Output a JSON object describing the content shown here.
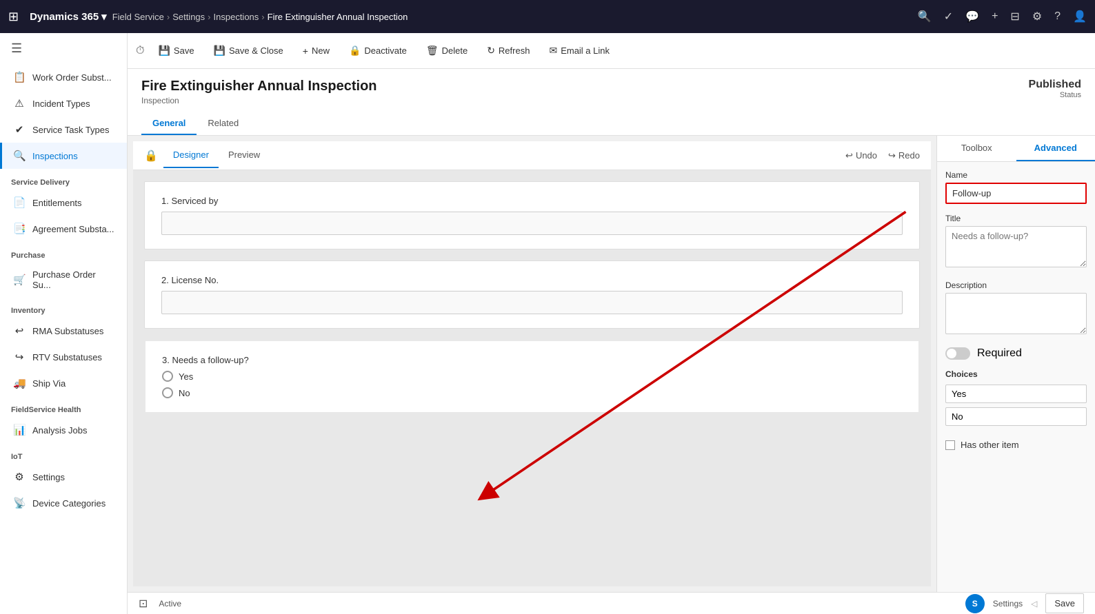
{
  "topnav": {
    "brand": "Dynamics 365",
    "chevron": "▾",
    "app": "Field Service",
    "breadcrumbs": [
      "Settings",
      "Inspections",
      "Fire Extinguisher Annual Inspection"
    ],
    "icons": [
      "🔍",
      "✓",
      "💬",
      "+",
      "⊟",
      "⚙",
      "?"
    ]
  },
  "sidebar": {
    "toggle_icon": "☰",
    "sections": [
      {
        "items": [
          {
            "id": "work-order-subst",
            "icon": "📋",
            "label": "Work Order Subst..."
          },
          {
            "id": "incident-types",
            "icon": "⚠",
            "label": "Incident Types"
          },
          {
            "id": "service-task-types",
            "icon": "✔",
            "label": "Service Task Types"
          },
          {
            "id": "inspections",
            "icon": "🔍",
            "label": "Inspections",
            "active": true
          }
        ]
      },
      {
        "title": "Service Delivery",
        "items": [
          {
            "id": "entitlements",
            "icon": "📄",
            "label": "Entitlements"
          },
          {
            "id": "agreement-substa",
            "icon": "📑",
            "label": "Agreement Substa..."
          }
        ]
      },
      {
        "title": "Purchase",
        "items": [
          {
            "id": "purchase-order-su",
            "icon": "🛒",
            "label": "Purchase Order Su..."
          }
        ]
      },
      {
        "title": "Inventory",
        "items": [
          {
            "id": "rma-substatuses",
            "icon": "↩",
            "label": "RMA Substatuses"
          },
          {
            "id": "rtv-substatuses",
            "icon": "↪",
            "label": "RTV Substatuses"
          },
          {
            "id": "ship-via",
            "icon": "🚚",
            "label": "Ship Via"
          }
        ]
      },
      {
        "title": "FieldService Health",
        "items": [
          {
            "id": "analysis-jobs",
            "icon": "📊",
            "label": "Analysis Jobs"
          }
        ]
      },
      {
        "title": "IoT",
        "items": [
          {
            "id": "iot-settings",
            "icon": "⚙",
            "label": "Settings"
          },
          {
            "id": "device-categories",
            "icon": "📡",
            "label": "Device Categories"
          }
        ]
      }
    ]
  },
  "commandbar": {
    "buttons": [
      {
        "id": "save",
        "icon": "💾",
        "label": "Save"
      },
      {
        "id": "save-close",
        "icon": "💾",
        "label": "Save & Close"
      },
      {
        "id": "new",
        "icon": "+",
        "label": "New"
      },
      {
        "id": "deactivate",
        "icon": "🔒",
        "label": "Deactivate"
      },
      {
        "id": "delete",
        "icon": "🗑",
        "label": "Delete"
      },
      {
        "id": "refresh",
        "icon": "↻",
        "label": "Refresh"
      },
      {
        "id": "email-link",
        "icon": "✉",
        "label": "Email a Link"
      }
    ]
  },
  "page": {
    "title": "Fire Extinguisher Annual Inspection",
    "subtitle": "Inspection",
    "status_label": "Published",
    "status_sub": "Status",
    "tabs": [
      "General",
      "Related"
    ],
    "active_tab": "General"
  },
  "designer": {
    "sub_tabs": [
      "Designer",
      "Preview"
    ],
    "active_sub_tab": "Designer",
    "undo_label": "Undo",
    "redo_label": "Redo",
    "form_fields": [
      {
        "id": "serviced-by",
        "number": "1",
        "label": "Serviced by",
        "type": "text"
      },
      {
        "id": "license-no",
        "number": "2",
        "label": "License No.",
        "type": "text"
      },
      {
        "id": "needs-followup",
        "number": "3",
        "label": "Needs a follow-up?",
        "type": "radio",
        "options": [
          "Yes",
          "No"
        ]
      }
    ]
  },
  "right_panel": {
    "tabs": [
      "Toolbox",
      "Advanced"
    ],
    "active_tab": "Advanced",
    "fields": {
      "name_label": "Name",
      "name_value": "Follow-up",
      "title_label": "Title",
      "title_placeholder": "Needs a follow-up?",
      "description_label": "Description",
      "description_value": "",
      "required_label": "Required",
      "choices_label": "Choices",
      "choices": [
        "Yes",
        "No"
      ],
      "has_other_label": "Has other item"
    }
  },
  "statusbar": {
    "icon": "⊡",
    "status": "Active",
    "save_label": "Save",
    "user_initial": "S",
    "user_label": "Settings"
  }
}
